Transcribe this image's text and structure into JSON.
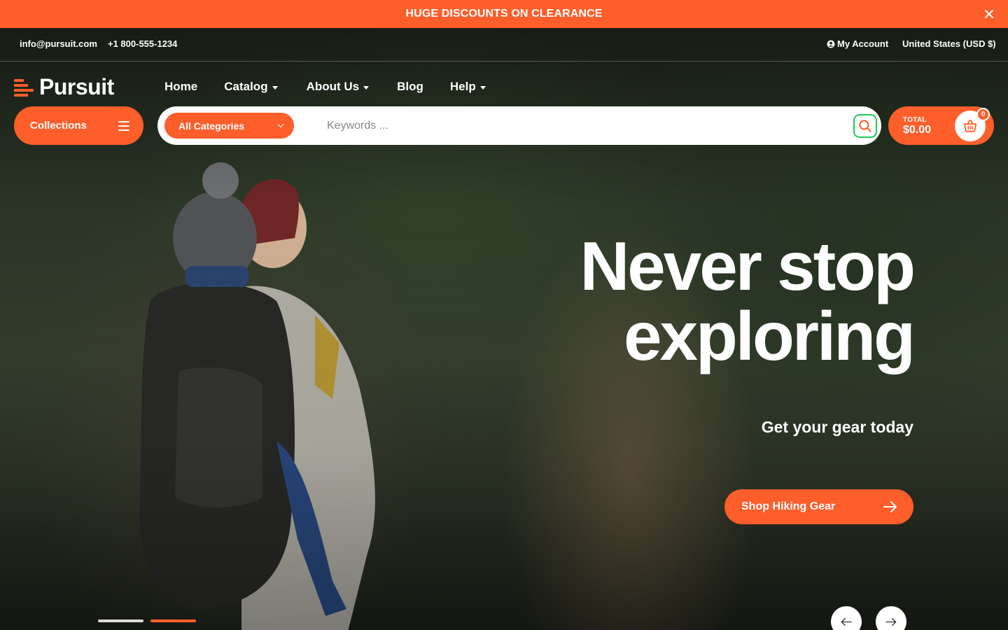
{
  "announcement": {
    "text": "HUGE DISCOUNTS ON CLEARANCE",
    "close_icon": "close-icon"
  },
  "utility": {
    "email": "info@pursuit.com",
    "phone": "+1 800-555-1234",
    "account": "My Account",
    "currency": "United States (USD $)"
  },
  "brand": {
    "name": "Pursuit",
    "accent": "#fe5e2a"
  },
  "nav": {
    "items": [
      {
        "label": "Home",
        "dropdown": false
      },
      {
        "label": "Catalog",
        "dropdown": true
      },
      {
        "label": "About Us",
        "dropdown": true
      },
      {
        "label": "Blog",
        "dropdown": false
      },
      {
        "label": "Help",
        "dropdown": true
      }
    ]
  },
  "search": {
    "collections_label": "Collections",
    "category_label": "All Categories",
    "placeholder": "Keywords ...",
    "value": ""
  },
  "cart": {
    "total_label": "TOTAL",
    "total_value": "$0.00",
    "count": "0"
  },
  "hero": {
    "headline_line1": "Never stop",
    "headline_line2": "exploring",
    "subheading": "Get your gear today",
    "cta_label": "Shop Hiking Gear"
  },
  "slider": {
    "slides": 2,
    "active": 2
  }
}
